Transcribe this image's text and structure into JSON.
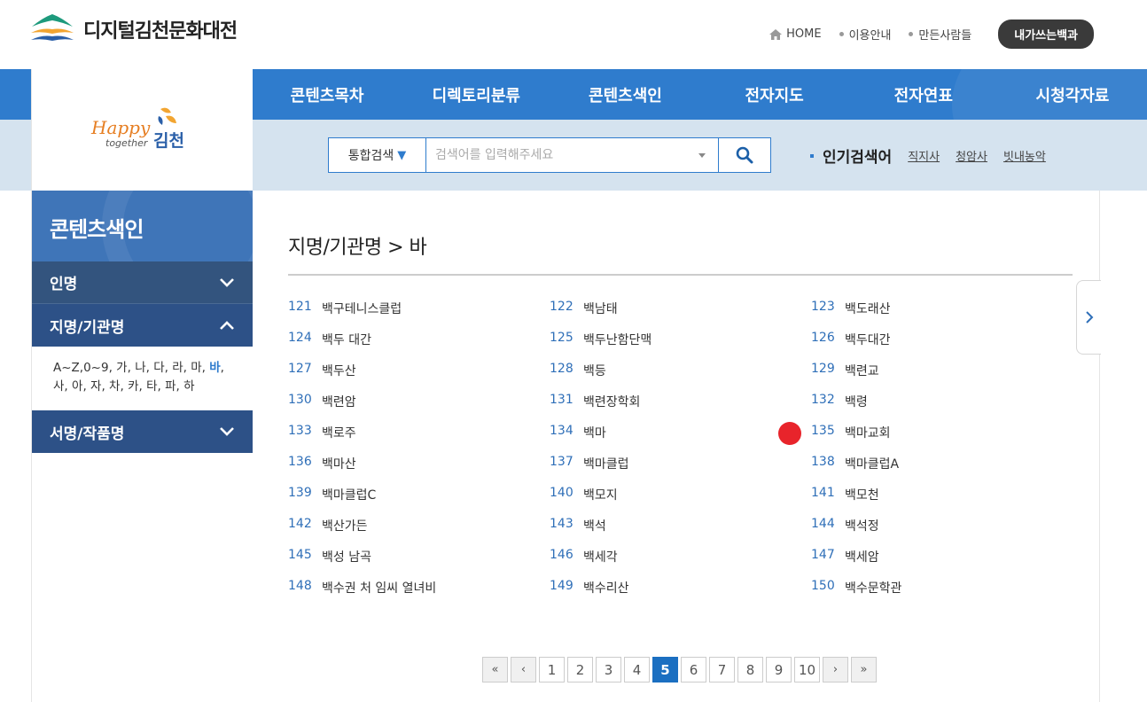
{
  "header": {
    "site_title": "디지털김천문화대전",
    "util_links": [
      "HOME",
      "이용안내",
      "만든사람들"
    ],
    "my_button": "내가쓰는백과"
  },
  "nav": {
    "menu": [
      "콘텐츠목차",
      "디렉토리분류",
      "콘텐츠색인",
      "전자지도",
      "전자연표",
      "시청각자료"
    ],
    "city_logo": "Happy together 김천"
  },
  "search": {
    "select_label": "통합검색",
    "placeholder": "검색어를 입력해주세요",
    "popular_title": "인기검색어",
    "popular_keywords": [
      "직지사",
      "청암사",
      "빗내농악"
    ]
  },
  "sidebar": {
    "title": "콘텐츠색인",
    "categories": [
      "인명",
      "지명/기관명",
      "서명/작품명"
    ],
    "alphabet": [
      "A~Z,0~9",
      "가",
      "나",
      "다",
      "라",
      "마",
      "바",
      "사",
      "아",
      "자",
      "차",
      "카",
      "타",
      "파",
      "하"
    ],
    "active_alpha": "바"
  },
  "main": {
    "title": "지명/기관명 > 바",
    "items": [
      {
        "num": "121",
        "name": "백구테니스클럽"
      },
      {
        "num": "122",
        "name": "백남태"
      },
      {
        "num": "123",
        "name": "백도래산"
      },
      {
        "num": "124",
        "name": "백두 대간"
      },
      {
        "num": "125",
        "name": "백두난함단맥"
      },
      {
        "num": "126",
        "name": "백두대간"
      },
      {
        "num": "127",
        "name": "백두산"
      },
      {
        "num": "128",
        "name": "백등"
      },
      {
        "num": "129",
        "name": "백련교"
      },
      {
        "num": "130",
        "name": "백련암"
      },
      {
        "num": "131",
        "name": "백련장학회"
      },
      {
        "num": "132",
        "name": "백령"
      },
      {
        "num": "133",
        "name": "백로주"
      },
      {
        "num": "134",
        "name": "백마"
      },
      {
        "num": "135",
        "name": "백마교회"
      },
      {
        "num": "136",
        "name": "백마산"
      },
      {
        "num": "137",
        "name": "백마클럽"
      },
      {
        "num": "138",
        "name": "백마클럽A"
      },
      {
        "num": "139",
        "name": "백마클럽C"
      },
      {
        "num": "140",
        "name": "백모지"
      },
      {
        "num": "141",
        "name": "백모천"
      },
      {
        "num": "142",
        "name": "백산가든"
      },
      {
        "num": "143",
        "name": "백석"
      },
      {
        "num": "144",
        "name": "백석정"
      },
      {
        "num": "145",
        "name": "백성 남곡"
      },
      {
        "num": "146",
        "name": "백세각"
      },
      {
        "num": "147",
        "name": "백세암"
      },
      {
        "num": "148",
        "name": "백수권 처 임씨 열녀비"
      },
      {
        "num": "149",
        "name": "백수리산"
      },
      {
        "num": "150",
        "name": "백수문학관"
      }
    ]
  },
  "pagination": {
    "first": "«",
    "prev": "‹",
    "pages": [
      "1",
      "2",
      "3",
      "4",
      "5",
      "6",
      "7",
      "8",
      "9",
      "10"
    ],
    "current": "5",
    "next": "›",
    "last": "»"
  },
  "colors": {
    "nav_blue": "#2f7ccd",
    "nav_light": "#d5e3ef",
    "sidebar_head": "#3f75b8",
    "sidebar_cat": "#2d5187",
    "link_number": "#2f6fb8",
    "page_active": "#1b6fc1",
    "marker_red": "#e8242b"
  }
}
